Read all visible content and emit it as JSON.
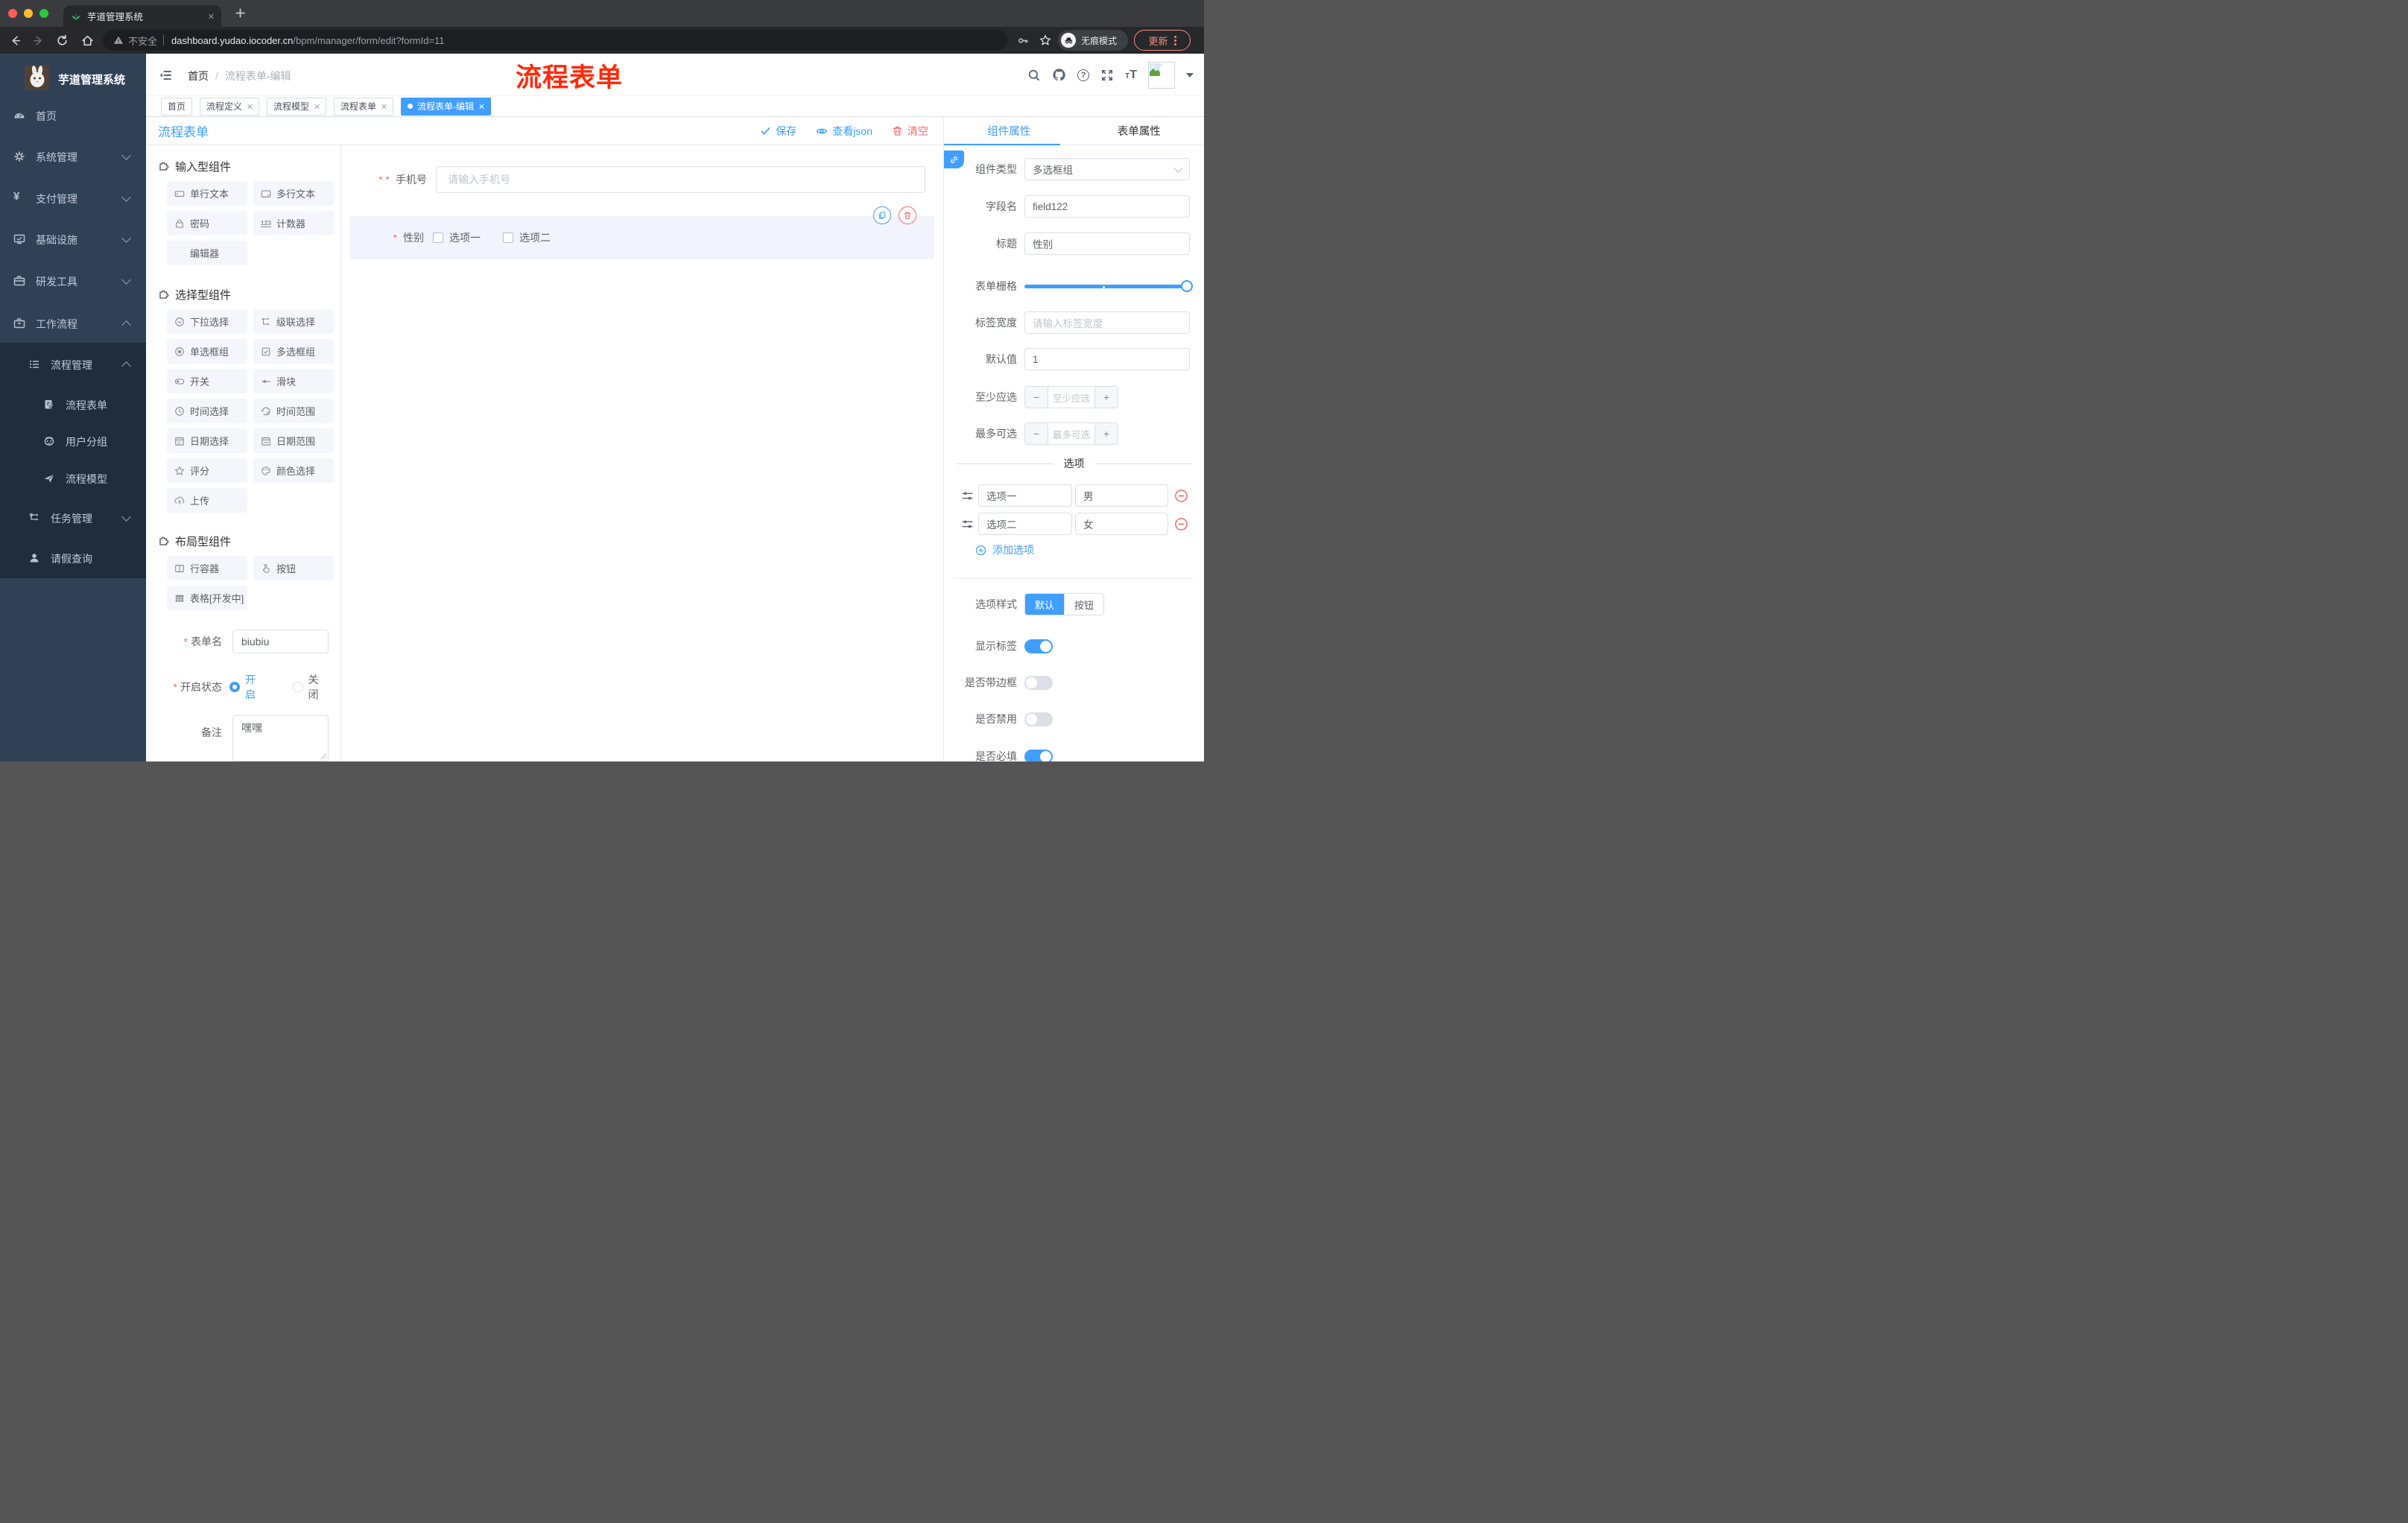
{
  "browser": {
    "tab_title": "芋道管理系统",
    "security_label": "不安全",
    "url_host": "dashboard.yudao.iocoder.cn",
    "url_path": "/bpm/manager/form/edit?formId=11",
    "incognito_label": "无痕模式",
    "update_label": "更新"
  },
  "sidebar": {
    "brand": "芋道管理系统",
    "items": [
      {
        "label": "首页"
      },
      {
        "label": "系统管理"
      },
      {
        "label": "支付管理"
      },
      {
        "label": "基础设施"
      },
      {
        "label": "研发工具"
      },
      {
        "label": "工作流程"
      },
      {
        "label": "流程管理"
      },
      {
        "label": "流程表单"
      },
      {
        "label": "用户分组"
      },
      {
        "label": "流程模型"
      },
      {
        "label": "任务管理"
      },
      {
        "label": "请假查询"
      }
    ]
  },
  "header": {
    "breadcrumb_home": "首页",
    "breadcrumb_current": "流程表单-编辑",
    "annotation": "流程表单"
  },
  "tags": [
    {
      "label": "首页"
    },
    {
      "label": "流程定义"
    },
    {
      "label": "流程模型"
    },
    {
      "label": "流程表单"
    },
    {
      "label": "流程表单-编辑"
    }
  ],
  "designer": {
    "title": "流程表单",
    "actions": {
      "save": "保存",
      "view_json": "查看json",
      "clear": "清空"
    },
    "palette": [
      {
        "title": "输入型组件",
        "items": [
          "单行文本",
          "多行文本",
          "密码",
          "计数器",
          "编辑器"
        ]
      },
      {
        "title": "选择型组件",
        "items": [
          "下拉选择",
          "级联选择",
          "单选框组",
          "多选框组",
          "开关",
          "滑块",
          "时间选择",
          "时间范围",
          "日期选择",
          "日期范围",
          "评分",
          "颜色选择",
          "上传"
        ]
      },
      {
        "title": "布局型组件",
        "items": [
          "行容器",
          "按钮",
          "表格[开发中]"
        ]
      }
    ],
    "meta": {
      "name_label": "表单名",
      "name_value": "biubiu",
      "status_label": "开启状态",
      "status_on": "开启",
      "status_off": "关闭",
      "remark_label": "备注",
      "remark_value": "嘿嘿"
    },
    "canvas": {
      "phone_label": "手机号",
      "phone_placeholder": "请输入手机号",
      "gender_label": "性别",
      "gender_options": [
        "选项一",
        "选项二"
      ]
    }
  },
  "panel": {
    "tabs": [
      "组件属性",
      "表单属性"
    ],
    "fields": {
      "type_label": "组件类型",
      "type_value": "多选框组",
      "field_label": "字段名",
      "field_value": "field122",
      "title_label": "标题",
      "title_value": "性别",
      "grid_label": "表单栅格",
      "labelw_label": "标签宽度",
      "labelw_placeholder": "请输入标签宽度",
      "default_label": "默认值",
      "default_value": "1",
      "min_label": "至少应选",
      "min_placeholder": "至少应选",
      "max_label": "最多可选",
      "max_placeholder": "最多可选"
    },
    "options_section": {
      "title": "选项",
      "options": [
        {
          "label": "选项一",
          "value": "男"
        },
        {
          "label": "选项二",
          "value": "女"
        }
      ],
      "add_label": "添加选项"
    },
    "style_section": {
      "style_label": "选项样式",
      "style_default": "默认",
      "style_button": "按钮",
      "toggles": [
        {
          "label": "显示标签"
        },
        {
          "label": "是否带边框"
        },
        {
          "label": "是否禁用"
        },
        {
          "label": "是否必填"
        }
      ]
    }
  },
  "colors": {
    "primary": "#409EFF",
    "danger": "#F56C6C",
    "sidebar": "#304156",
    "submenu": "#1f2d3d"
  }
}
